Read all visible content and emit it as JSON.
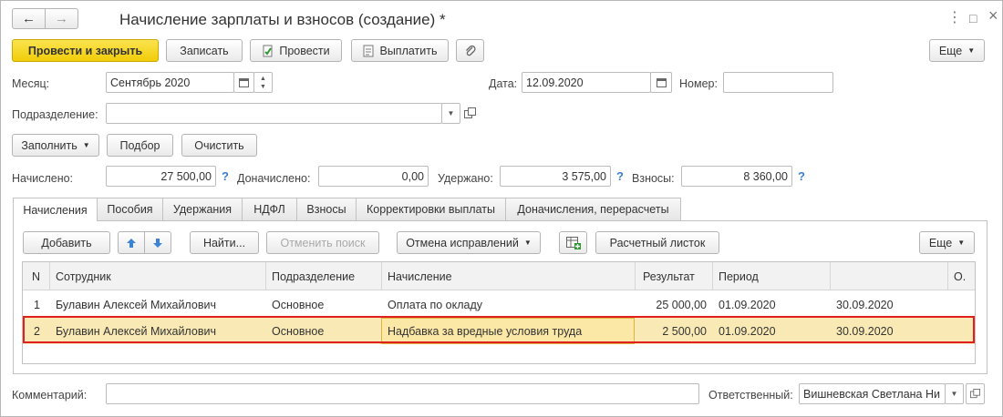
{
  "window": {
    "title": "Начисление зарплаты и взносов (создание) *",
    "nav_back": "←",
    "nav_forward": "→",
    "menu": "⋮",
    "restore": "□",
    "close": "×"
  },
  "toolbar": {
    "post_close": "Провести и закрыть",
    "save": "Записать",
    "post": "Провести",
    "pay": "Выплатить",
    "more": "Еще"
  },
  "header": {
    "month_label": "Месяц:",
    "month_value": "Сентябрь 2020",
    "date_label": "Дата:",
    "date_value": "12.09.2020",
    "number_label": "Номер:",
    "number_value": "",
    "division_label": "Подразделение:",
    "division_value": ""
  },
  "actions": {
    "fill": "Заполнить",
    "select": "Подбор",
    "clear": "Очистить"
  },
  "totals": {
    "accrued_label": "Начислено:",
    "accrued_value": "27 500,00",
    "additional_label": "Доначислено:",
    "additional_value": "0,00",
    "withheld_label": "Удержано:",
    "withheld_value": "3 575,00",
    "contrib_label": "Взносы:",
    "contrib_value": "8 360,00",
    "help": "?"
  },
  "tabs": [
    "Начисления",
    "Пособия",
    "Удержания",
    "НДФЛ",
    "Взносы",
    "Корректировки выплаты",
    "Доначисления, перерасчеты"
  ],
  "table_toolbar": {
    "add": "Добавить",
    "find": "Найти...",
    "cancel_search": "Отменить поиск",
    "cancel_corrections": "Отмена исправлений",
    "payslip": "Расчетный листок",
    "more": "Еще"
  },
  "table": {
    "columns": [
      "N",
      "Сотрудник",
      "Подразделение",
      "Начисление",
      "Результат",
      "Период",
      "",
      "О."
    ],
    "rows": [
      {
        "n": "1",
        "employee": "Булавин Алексей Михайлович",
        "division": "Основное",
        "accrual": "Оплата по окладу",
        "result": "25 000,00",
        "from": "01.09.2020",
        "to": "30.09.2020"
      },
      {
        "n": "2",
        "employee": "Булавин Алексей Михайлович",
        "division": "Основное",
        "accrual": "Надбавка за вредные условия труда",
        "result": "2 500,00",
        "from": "01.09.2020",
        "to": "30.09.2020"
      }
    ]
  },
  "footer": {
    "comment_label": "Комментарий:",
    "comment_value": "",
    "responsible_label": "Ответственный:",
    "responsible_value": "Вишневская Светлана Ни"
  },
  "colors": {
    "accent_yellow": "#f1cc08",
    "selection_row": "#f9eab5",
    "highlight_border": "#e0201f",
    "help_blue": "#3b7fd0"
  }
}
